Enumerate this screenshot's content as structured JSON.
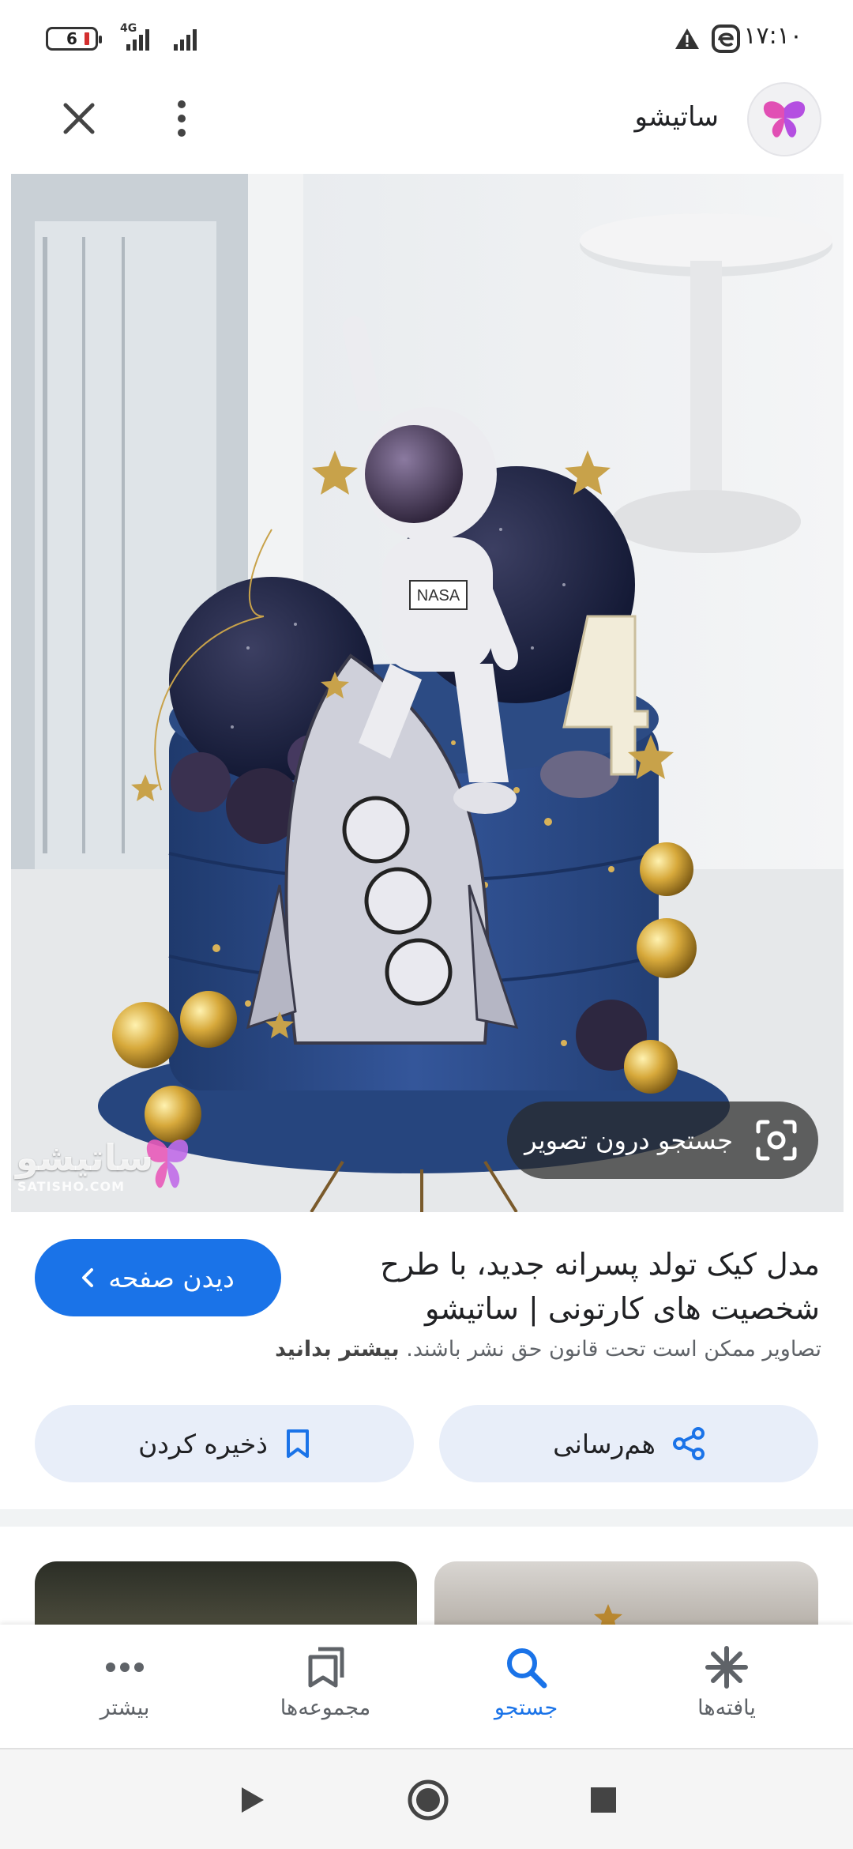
{
  "status_bar": {
    "time": "۱۷:۱۰",
    "battery_level": "6",
    "network_type": "4G"
  },
  "header": {
    "site_name": "ساتیشو"
  },
  "preview": {
    "lens_label": "جستجو درون تصویر",
    "watermark_text": "ساتیشو",
    "watermark_sub": "SATISHO.COM"
  },
  "result": {
    "title": "مدل کیک تولد پسرانه جدید، با طرح شخصیت های کارتونی | ساتیشو",
    "visit_label": "دیدن صفحه",
    "copyright_text": "تصاویر ممکن است تحت قانون حق نشر باشند.",
    "learn_more": "بیشتر بدانید"
  },
  "actions": {
    "share_label": "هم‌رسانی",
    "save_label": "ذخیره کردن"
  },
  "bottom_nav": {
    "items": [
      {
        "label": "یافته‌ها",
        "icon": "discover-icon",
        "active": false
      },
      {
        "label": "جستجو",
        "icon": "search-icon",
        "active": true
      },
      {
        "label": "مجموعه‌ها",
        "icon": "collections-icon",
        "active": false
      },
      {
        "label": "بیشتر",
        "icon": "more-icon",
        "active": false
      }
    ]
  },
  "colors": {
    "accent": "#1a73e8",
    "chip_bg": "#e8eef9",
    "cake_blue": "#2c4b84"
  }
}
